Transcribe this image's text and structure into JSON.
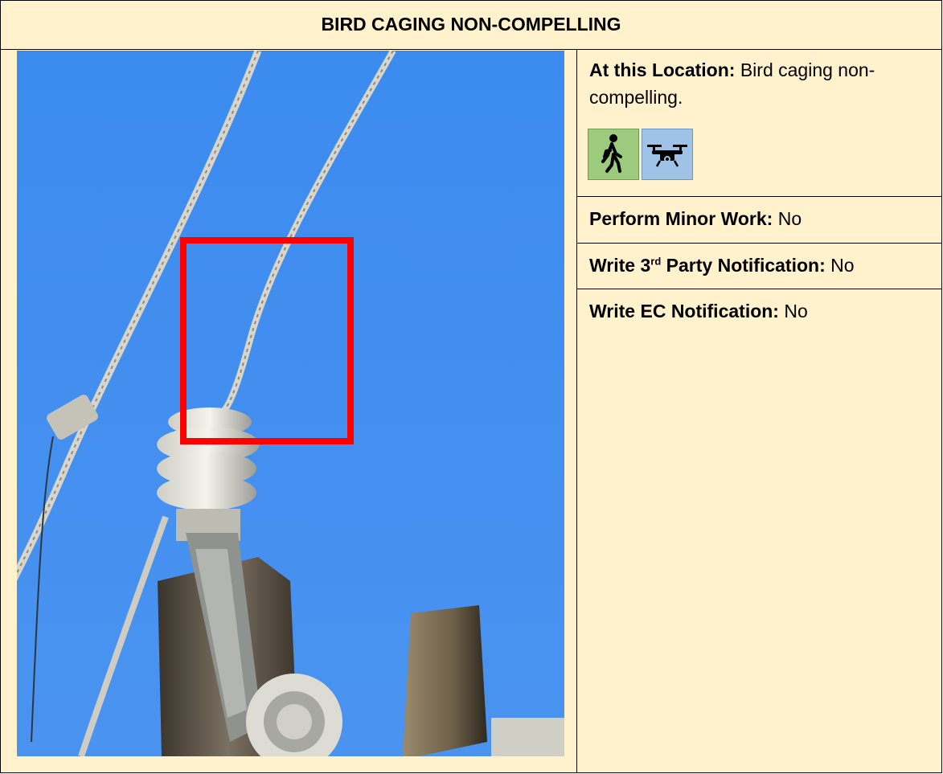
{
  "title": "BIRD CAGING NON-COMPELLING",
  "location": {
    "label": "At this Location:",
    "value": "Bird caging non-compelling."
  },
  "icons": [
    "walking-person-icon",
    "drone-icon"
  ],
  "minor_work": {
    "label": "Perform Minor Work:",
    "value": "No"
  },
  "third_party": {
    "label_prefix": "Write 3",
    "label_sup": "rd",
    "label_suffix": " Party Notification:",
    "value": "No"
  },
  "ec_notification": {
    "label": "Write EC Notification:",
    "value": "No"
  },
  "colors": {
    "background": "#fff2cc",
    "highlight_box": "#ff0000",
    "sky": "#3f8ef0"
  }
}
